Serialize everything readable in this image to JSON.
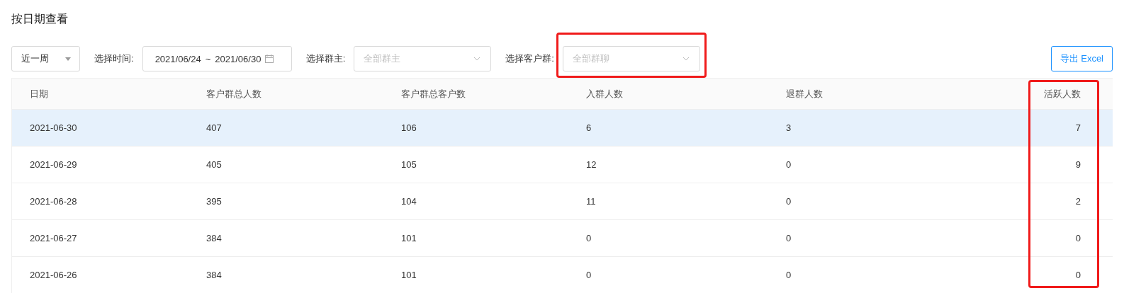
{
  "title": "按日期查看",
  "filters": {
    "period": {
      "value": "近一周"
    },
    "time": {
      "label": "选择时间:",
      "start": "2021/06/24",
      "separator": "~",
      "end": "2021/06/30"
    },
    "owner": {
      "label": "选择群主:",
      "placeholder": "全部群主",
      "highlighted": false
    },
    "group": {
      "label": "选择客户群:",
      "placeholder": "全部群聊",
      "highlighted": true
    },
    "export": "导出 Excel"
  },
  "table": {
    "columns": [
      {
        "label": "日期",
        "highlighted": false
      },
      {
        "label": "客户群总人数",
        "highlighted": false
      },
      {
        "label": "客户群总客户数",
        "highlighted": false
      },
      {
        "label": "入群人数",
        "highlighted": false
      },
      {
        "label": "退群人数",
        "highlighted": false
      },
      {
        "label": "活跃人数",
        "highlighted": true
      }
    ],
    "rows": [
      {
        "hover": true,
        "cells": [
          "2021-06-30",
          "407",
          "106",
          "6",
          "3",
          "7"
        ]
      },
      {
        "hover": false,
        "cells": [
          "2021-06-29",
          "405",
          "105",
          "12",
          "0",
          "9"
        ]
      },
      {
        "hover": false,
        "cells": [
          "2021-06-28",
          "395",
          "104",
          "11",
          "0",
          "2"
        ]
      },
      {
        "hover": false,
        "cells": [
          "2021-06-27",
          "384",
          "101",
          "0",
          "0",
          "0"
        ]
      },
      {
        "hover": false,
        "cells": [
          "2021-06-26",
          "384",
          "101",
          "0",
          "0",
          "0"
        ]
      }
    ]
  }
}
